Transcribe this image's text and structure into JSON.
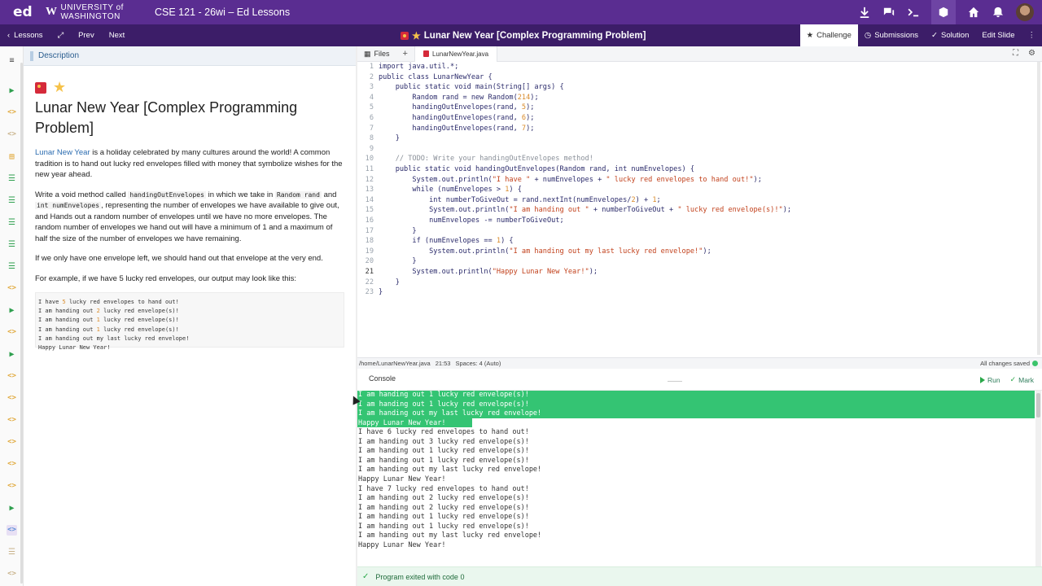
{
  "topbar": {
    "logo": "ed",
    "university": "UNIVERSITY of WASHINGTON",
    "course": "CSE 121 - 26wi – Ed Lessons"
  },
  "navbar": {
    "lessons": "Lessons",
    "prev": "Prev",
    "next": "Next",
    "title": "Lunar New Year [Complex Programming Problem]",
    "tabs": [
      "Challenge",
      "Submissions",
      "Solution",
      "Edit Slide"
    ]
  },
  "description": {
    "header": "Description",
    "title": "Lunar New Year [Complex Programming Problem]",
    "link": "Lunar New Year",
    "p1_rest": " is a holiday celebrated by many cultures around the world! A common tradition is to hand out lucky red envelopes filled with money that symbolize wishes for the new year ahead.",
    "p2_a": "Write a void method called ",
    "p2_code1": "handingOutEnvelopes",
    "p2_b": " in which we take in ",
    "p2_code2": "Random rand",
    "p2_c": " and ",
    "p2_code3": "int numEnvelopes",
    "p2_d": ", representing the number of envelopes we have available to give out, and Hands out a random number of envelopes until we have no more envelopes. The random number of envelopes we hand out will have a minimum of 1 and a maximum of half the size of the number of envelopes we have remaining.",
    "p3": "If we only have one envelope left, we should hand out that envelope at the very end.",
    "p4": "For example, if we have 5 lucky red envelopes, our output may look like this:",
    "example": [
      [
        "I have ",
        "5",
        " lucky red envelopes to hand out!"
      ],
      [
        "I am handing out ",
        "2",
        " lucky red envelope(s)!"
      ],
      [
        "I am handing out ",
        "1",
        " lucky red envelope(s)!"
      ],
      [
        "I am handing out ",
        "1",
        " lucky red envelope(s)!"
      ],
      [
        "I am handing out my last lucky red envelope!",
        "",
        ""
      ],
      [
        "Happy Lunar New Year!",
        "",
        ""
      ]
    ]
  },
  "editor": {
    "files_label": "Files",
    "file_tab": "LunarNewYear.java",
    "status_path": "/home/LunarNewYear.java",
    "status_pos": "21:53",
    "status_spaces": "Spaces: 4 (Auto)",
    "saved": "All changes saved",
    "lines": [
      "import java.util.*;",
      "public class LunarNewYear {",
      "    public static void main(String[] args) {",
      "        Random rand = new Random(214);",
      "        handingOutEnvelopes(rand, 5);",
      "        handingOutEnvelopes(rand, 6);",
      "        handingOutEnvelopes(rand, 7);",
      "    }",
      "",
      "    // TODO: Write your handingOutEnvelopes method!",
      "    public static void handingOutEnvelopes(Random rand, int numEnvelopes) {",
      "        System.out.println(\"I have \" + numEnvelopes + \" lucky red envelopes to hand out!\");",
      "        while (numEnvelopes > 1) {",
      "            int numberToGiveOut = rand.nextInt(numEnvelopes/2) + 1;",
      "            System.out.println(\"I am handing out \" + numberToGiveOut + \" lucky red envelope(s)!\");",
      "            numEnvelopes -= numberToGiveOut;",
      "        }",
      "        if (numEnvelopes == 1) {",
      "            System.out.println(\"I am handing out my last lucky red envelope!\");",
      "        }",
      "        System.out.println(\"Happy Lunar New Year!\");",
      "    }",
      "}"
    ],
    "current_line": 21
  },
  "console": {
    "tab": "Console",
    "run": "Run",
    "mark": "Mark",
    "highlighted": [
      "I am handing out 1 lucky red envelope(s)!",
      "I am handing out 1 lucky red envelope(s)!",
      "I am handing out my last lucky red envelope!",
      "Happy Lunar New Year!"
    ],
    "lines": [
      "I have 6 lucky red envelopes to hand out!",
      "I am handing out 3 lucky red envelope(s)!",
      "I am handing out 1 lucky red envelope(s)!",
      "I am handing out 1 lucky red envelope(s)!",
      "I am handing out my last lucky red envelope!",
      "Happy Lunar New Year!",
      "I have 7 lucky red envelopes to hand out!",
      "I am handing out 2 lucky red envelope(s)!",
      "I am handing out 2 lucky red envelope(s)!",
      "I am handing out 1 lucky red envelope(s)!",
      "I am handing out 1 lucky red envelope(s)!",
      "I am handing out my last lucky red envelope!",
      "Happy Lunar New Year!"
    ],
    "exit": "Program exited with code 0"
  },
  "colors": {
    "brand": "#5a2d91",
    "nav": "#3c1d68",
    "success": "#34c473"
  }
}
